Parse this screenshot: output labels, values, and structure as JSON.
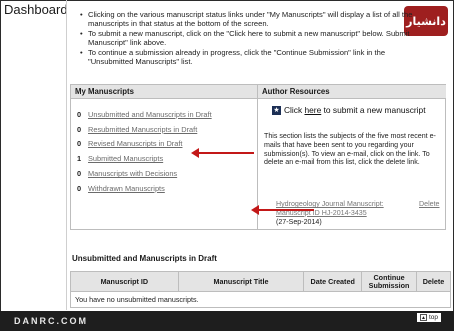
{
  "header": {
    "title": "Dashboard"
  },
  "instructions": [
    "Clicking on the various manuscript status links under \"My Manuscripts\" will display a list of all the manuscripts in that status at the bottom of the screen.",
    "To submit a new manuscript, click on the \"Click here to submit a new manuscript\" below. Submit Manuscript\" link above.",
    "To continue a submission already in progress, click the \"Continue Submission\" link in the \"Unsubmitted Manuscripts\" list."
  ],
  "logo": {
    "text": "دانشیار"
  },
  "my_manuscripts": {
    "heading": "My Manuscripts",
    "items": [
      {
        "count": "0",
        "label": "Unsubmitted and Manuscripts in Draft"
      },
      {
        "count": "0",
        "label": "Resubmitted Manuscripts in Draft"
      },
      {
        "count": "0",
        "label": "Revised Manuscripts in Draft"
      },
      {
        "count": "1",
        "label": "Submitted Manuscripts"
      },
      {
        "count": "0",
        "label": "Manuscripts with Decisions"
      },
      {
        "count": "0",
        "label": "Withdrawn Manuscripts"
      }
    ]
  },
  "author_resources": {
    "heading": "Author Resources",
    "submit_prefix": "Click",
    "submit_link": "here",
    "submit_suffix": "to submit a new manuscript",
    "description": "This section lists the subjects of the five most recent e-mails that have been sent to you regarding your submission(s). To view an e-mail, click on the link. To delete an e-mail from this list, click the delete link.",
    "email_line1": "Hydrogeology Journal Manuscript:",
    "email_line2": "Manuscript ID HJ-2014-3435",
    "email_date": "(27-Sep-2014)",
    "delete_label": "Delete"
  },
  "unsubmitted": {
    "title": "Unsubmitted and Manuscripts in Draft",
    "columns": [
      "Manuscript ID",
      "Manuscript Title",
      "Date Created",
      "Continue Submission",
      "Delete"
    ],
    "empty_message": "You have no unsubmitted manuscripts."
  },
  "footer": {
    "brand": "DANRC.COM",
    "top_label": "top"
  },
  "colors": {
    "arrow": "#c31818",
    "header_bg": "#e4e4e4",
    "link_gray": "#6b6b6b",
    "footer_bg": "#1e1e1e"
  }
}
